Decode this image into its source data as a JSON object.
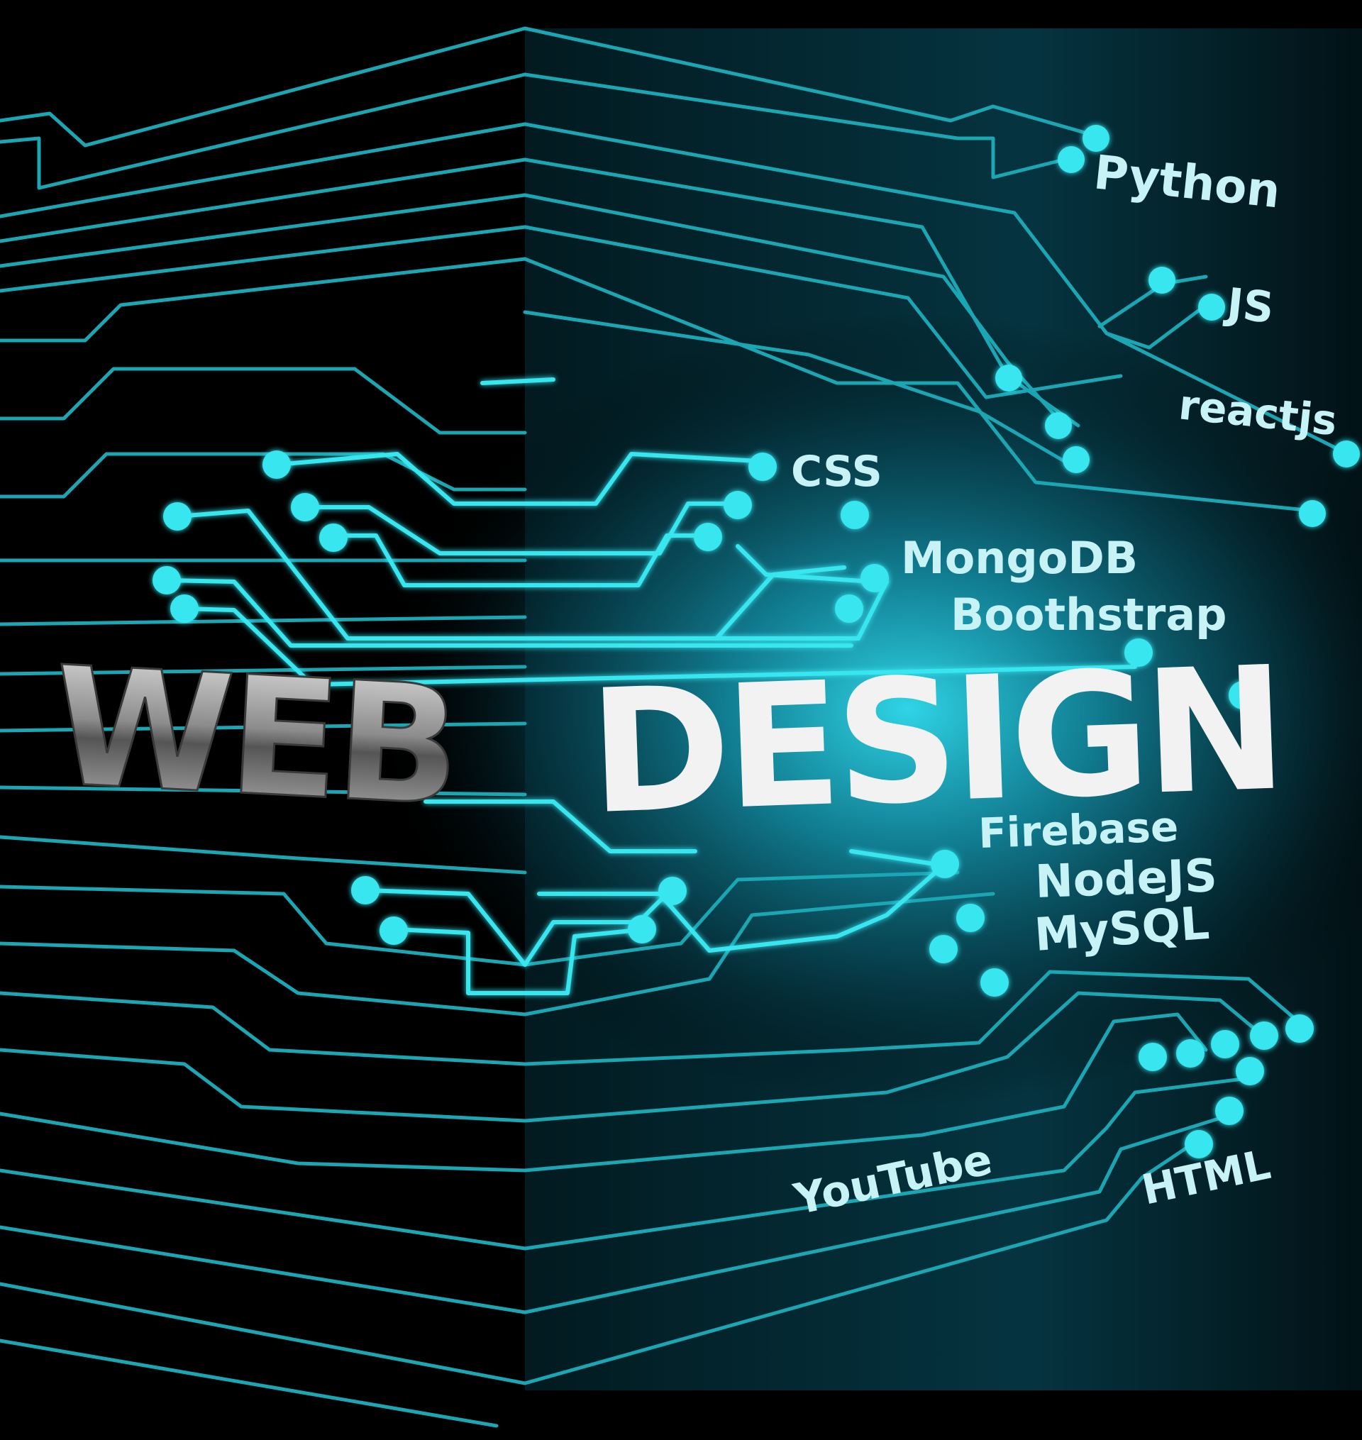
{
  "title": {
    "word_left": "WEB",
    "word_right": "DESIGN"
  },
  "tech_labels": {
    "python": "Python",
    "js": "JS",
    "reactjs": "reactjs",
    "css": "CSS",
    "mongodb": "MongoDB",
    "bootstrap": "Boothstrap",
    "firebase": "Firebase",
    "nodejs": "NodeJS",
    "mysql": "MySQL",
    "youtube": "YouTube",
    "html": "HTML"
  },
  "colors": {
    "background": "#000000",
    "circuit": "#1aa6b3",
    "circuit_bright": "#39e6f0",
    "glow": "#17c3d8",
    "label": "#c8f3f6",
    "title": "#f2f2f2"
  }
}
